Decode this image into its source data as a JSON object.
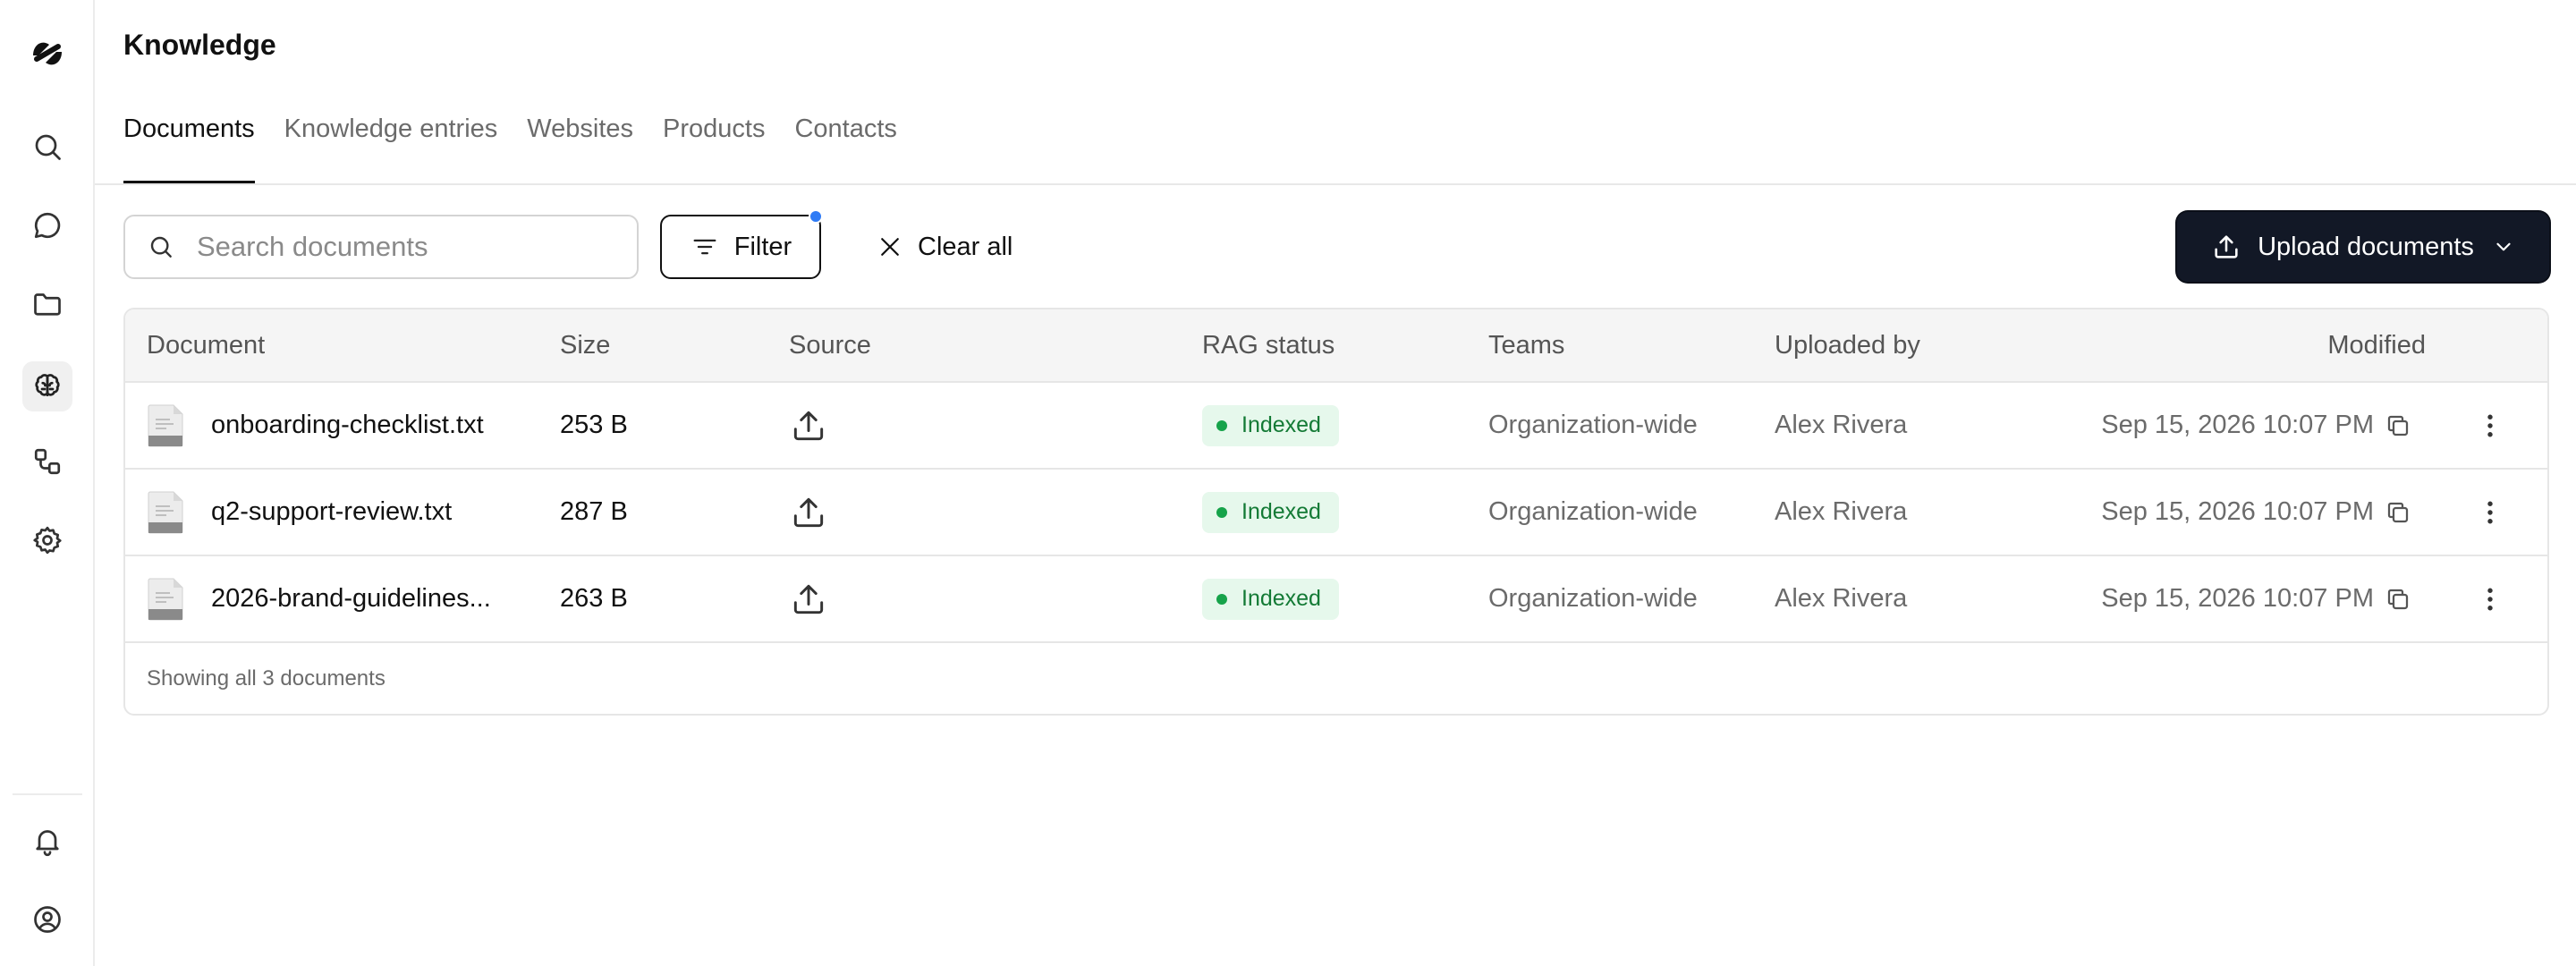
{
  "app": {
    "logo_icon": "brand-logo-icon"
  },
  "sidebar": {
    "items": [
      {
        "name": "search",
        "icon": "search-icon"
      },
      {
        "name": "chat",
        "icon": "chat-bubble-icon"
      },
      {
        "name": "folder",
        "icon": "folder-icon"
      },
      {
        "name": "knowledge",
        "icon": "brain-icon",
        "active": true
      },
      {
        "name": "workflows",
        "icon": "workflow-icon"
      },
      {
        "name": "settings",
        "icon": "gear-icon"
      }
    ],
    "bottom": [
      {
        "name": "notifications",
        "icon": "bell-icon"
      },
      {
        "name": "profile",
        "icon": "user-circle-icon"
      }
    ]
  },
  "header": {
    "title": "Knowledge",
    "tabs": [
      {
        "label": "Documents",
        "active": true
      },
      {
        "label": "Knowledge entries",
        "active": false
      },
      {
        "label": "Websites",
        "active": false
      },
      {
        "label": "Products",
        "active": false
      },
      {
        "label": "Contacts",
        "active": false
      }
    ]
  },
  "toolbar": {
    "search_placeholder": "Search documents",
    "search_value": "",
    "filter_label": "Filter",
    "filter_active": true,
    "clear_label": "Clear all",
    "upload_label": "Upload documents"
  },
  "table": {
    "columns": [
      "Document",
      "Size",
      "Source",
      "RAG status",
      "Teams",
      "Uploaded by",
      "Modified"
    ],
    "rows": [
      {
        "document": "onboarding-checklist.txt",
        "size": "253 B",
        "source_icon": "upload-icon",
        "rag_status": "Indexed",
        "teams": "Organization-wide",
        "uploaded_by": "Alex Rivera",
        "modified": "Sep 15, 2026 10:07 PM"
      },
      {
        "document": "q2-support-review.txt",
        "size": "287 B",
        "source_icon": "upload-icon",
        "rag_status": "Indexed",
        "teams": "Organization-wide",
        "uploaded_by": "Alex Rivera",
        "modified": "Sep 15, 2026 10:07 PM"
      },
      {
        "document": "2026-brand-guidelines...",
        "size": "263 B",
        "source_icon": "upload-icon",
        "rag_status": "Indexed",
        "teams": "Organization-wide",
        "uploaded_by": "Alex Rivera",
        "modified": "Sep 15, 2026 10:07 PM"
      }
    ],
    "footer": "Showing all 3 documents"
  },
  "colors": {
    "accent_dark": "#121826",
    "filter_dot": "#2f7bf5",
    "indexed_bg": "#e6f8ec",
    "indexed_text": "#137a35"
  }
}
